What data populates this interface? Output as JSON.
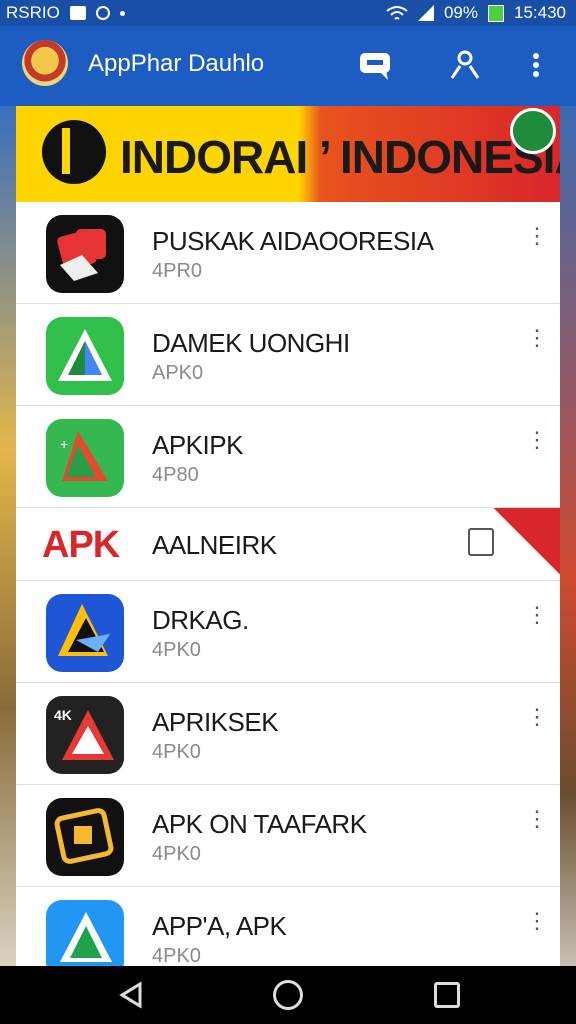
{
  "status_bar": {
    "carrier": "RSRIO",
    "battery_percent": "09%",
    "time": "15:430"
  },
  "app_bar": {
    "title": "AppPhar Dauhlo"
  },
  "banner": {
    "text": "INDORAI ’ INDONESIA"
  },
  "apps": [
    {
      "name": "PUSKAK AIDAOORESIA",
      "subtitle": "4PR0",
      "icon": "red-tiles-icon"
    },
    {
      "name": "DAMEK UONGHI",
      "subtitle": "APK0",
      "icon": "green-triangle-icon"
    },
    {
      "name": "APKIPK",
      "subtitle": "4P80",
      "icon": "green-triangle-icon"
    },
    {
      "name": "DRKAG.",
      "subtitle": "4PK0",
      "icon": "blue-arrow-icon"
    },
    {
      "name": "APRIKSEK",
      "subtitle": "4PK0",
      "icon": "dark-triangle-icon"
    },
    {
      "name": "APK ON TAAFARK",
      "subtitle": "4PK0",
      "icon": "chip-icon"
    },
    {
      "name": "APP'A, APK",
      "subtitle": "4PK0",
      "icon": "blue-triangle-icon"
    }
  ],
  "ad_row": {
    "logo_text": "APK",
    "name": "AALNEIRK"
  },
  "colors": {
    "app_bar": "#1d5cc0",
    "status_bar": "#1a4fa8",
    "banner_yellow": "#ffd500",
    "banner_red": "#d9262a"
  }
}
